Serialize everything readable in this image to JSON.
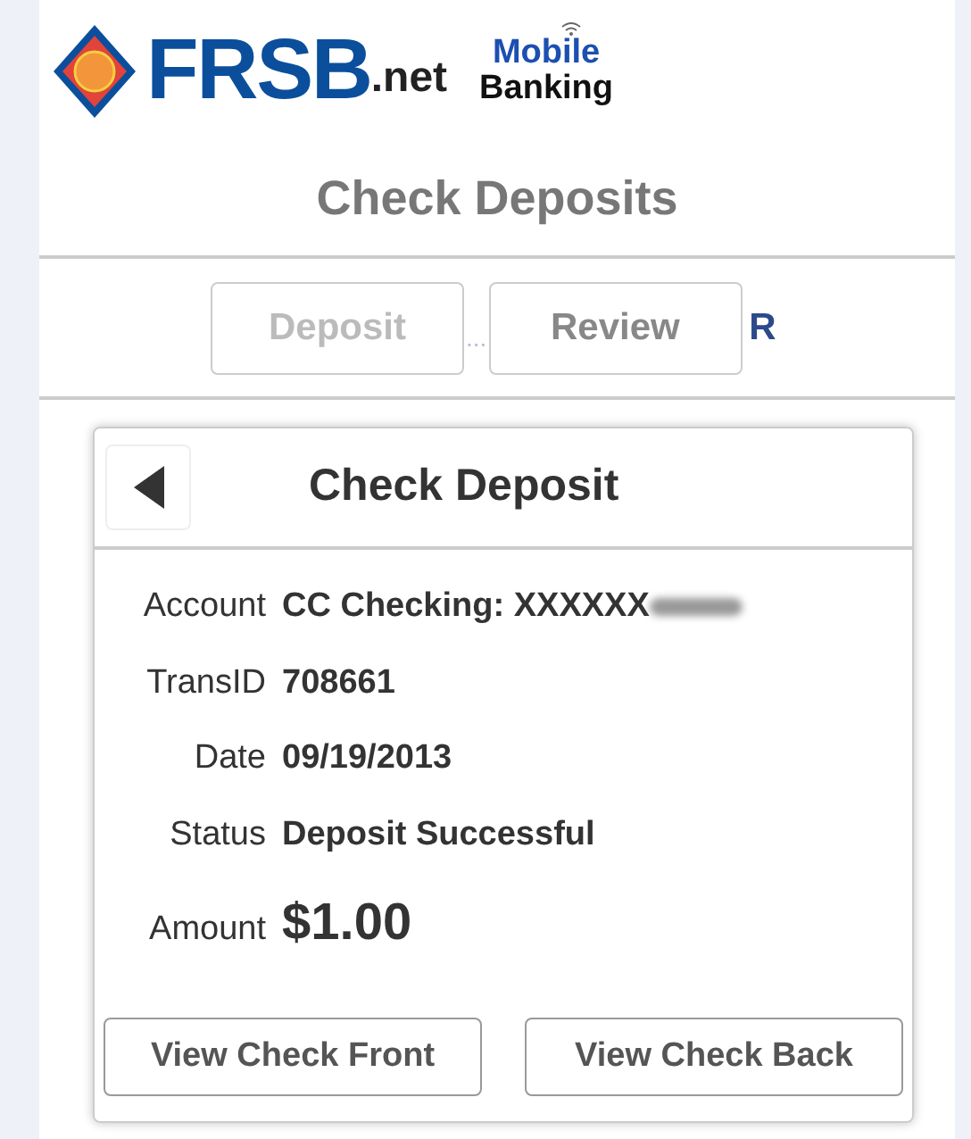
{
  "logo": {
    "brand": "FRSB",
    "suffix": ".net",
    "line_1": "Mobile",
    "line_2": "Banking"
  },
  "page_title": "Check Deposits",
  "steps": [
    {
      "label": "Deposit",
      "selected": false
    },
    {
      "label": "Review",
      "selected": true
    }
  ],
  "step_separator": "...",
  "next_step_partial": "R",
  "card": {
    "title": "Check Deposit",
    "fields": [
      {
        "label": "Account",
        "value": "CC Checking: XXXXXX",
        "redacted": true,
        "kind": "text"
      },
      {
        "label": "TransID",
        "value": "708661",
        "redacted": false,
        "kind": "text"
      },
      {
        "label": "Date",
        "value": "09/19/2013",
        "redacted": false,
        "kind": "text"
      },
      {
        "label": "Status",
        "value": "Deposit Successful",
        "redacted": false,
        "kind": "text"
      },
      {
        "label": "Amount",
        "value": "$1.00",
        "redacted": false,
        "kind": "amount"
      }
    ],
    "buttons": [
      "View Check Front",
      "View Check Back"
    ]
  }
}
